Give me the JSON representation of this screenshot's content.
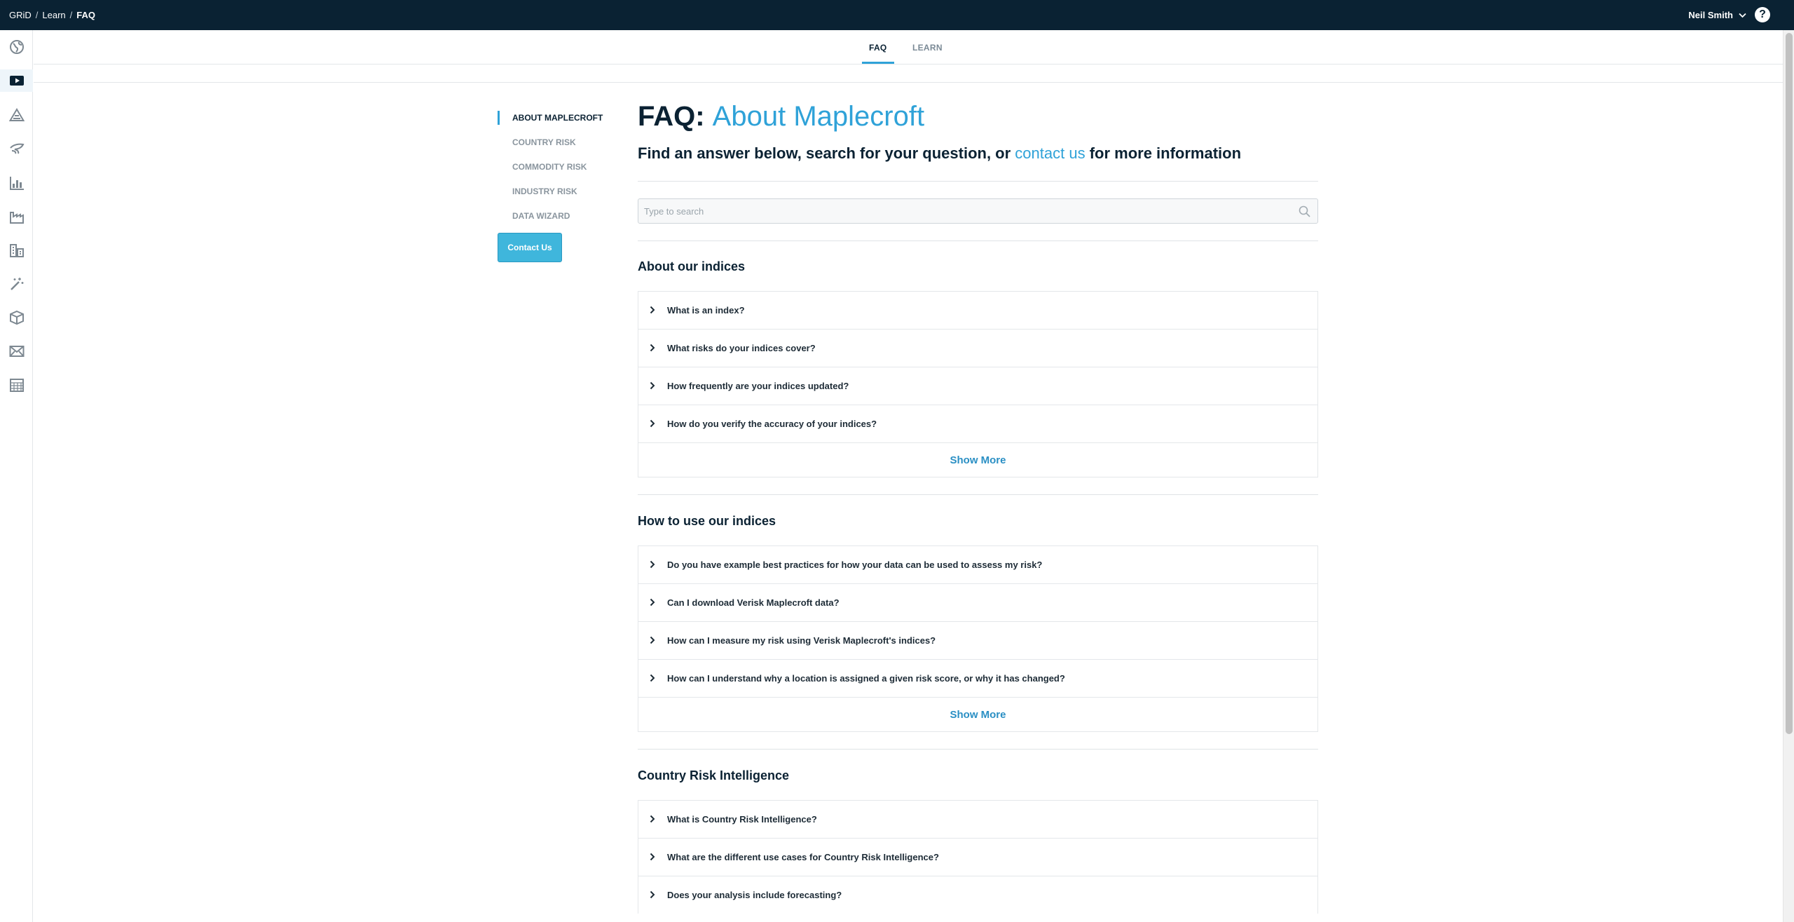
{
  "breadcrumb": [
    "GRiD",
    "Learn",
    "FAQ"
  ],
  "user": {
    "name": "Neil Smith",
    "help_label": "?"
  },
  "rail_icons": [
    "globe-icon",
    "video-icon",
    "alert-triangle-icon",
    "commodity-icon",
    "chart-icon",
    "factory-icon",
    "buildings-icon",
    "wand-icon",
    "box-icon",
    "mail-icon",
    "calendar-icon"
  ],
  "tabs": [
    {
      "label": "FAQ"
    },
    {
      "label": "LEARN"
    }
  ],
  "sidenav": [
    {
      "label": "ABOUT MAPLECROFT"
    },
    {
      "label": "COUNTRY RISK"
    },
    {
      "label": "COMMODITY RISK"
    },
    {
      "label": "INDUSTRY RISK"
    },
    {
      "label": "DATA WIZARD"
    }
  ],
  "contact_button": "Contact Us",
  "page": {
    "title_bold": "FAQ:",
    "title_light": "About Maplecroft",
    "sub_before": "Find an answer below, search for your question, or",
    "sub_link": "contact us",
    "sub_after": "for more information",
    "search_placeholder": "Type to search"
  },
  "sections": [
    {
      "title": "About our indices",
      "questions": [
        "What is an index?",
        "What risks do your indices cover?",
        "How frequently are your indices updated?",
        "How do you verify the accuracy of your indices?"
      ],
      "more": "Show More"
    },
    {
      "title": "How to use our indices",
      "questions": [
        "Do you have example best practices for how your data can be used to assess my risk?",
        "Can I download Verisk Maplecroft data?",
        "How can I measure my risk using Verisk Maplecroft's indices?",
        "How can I understand why a location is assigned a given risk score, or why it has changed?"
      ],
      "more": "Show More"
    },
    {
      "title": "Country Risk Intelligence",
      "questions": [
        "What is Country Risk Intelligence?",
        "What are the different use cases for Country Risk Intelligence?",
        "Does your analysis include forecasting?"
      ]
    }
  ],
  "colors": {
    "topbar": "#0a2233",
    "accent": "#2fa2d8",
    "button": "#3fb6dc"
  }
}
